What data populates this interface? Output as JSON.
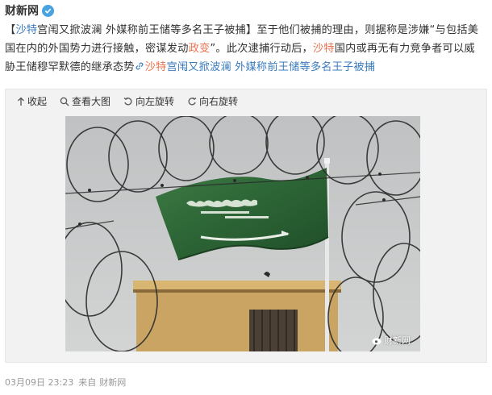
{
  "header": {
    "author": "财新网"
  },
  "post": {
    "bracket_open": "【",
    "topic1": "沙特",
    "title_rest": "宫闱又掀波澜 外媒称前王储等多名王子被捕",
    "bracket_close": "】",
    "body1": "至于他们被捕的理由，则据称是涉嫌“与包括美国在内的外国势力进行接触，密谋发动",
    "coup": "政变",
    "body2": "”。此次逮捕行动后，",
    "topic2": "沙特",
    "body3": "国内或再无有力竞争者可以威胁王储穆罕默德的继承态势",
    "link_topic": "沙特",
    "link_rest": "宫闱又掀波澜 外媒称前王储等多名王子被捕"
  },
  "toolbar": {
    "collapse": "收起",
    "view_large": "查看大图",
    "rotate_left": "向左旋转",
    "rotate_right": "向右旋转"
  },
  "image": {
    "watermark": "财新网",
    "flag_color": "#2f6b3a"
  },
  "footer": {
    "time": "03月09日 23:23",
    "source_label": "来自",
    "source": "财新网"
  }
}
